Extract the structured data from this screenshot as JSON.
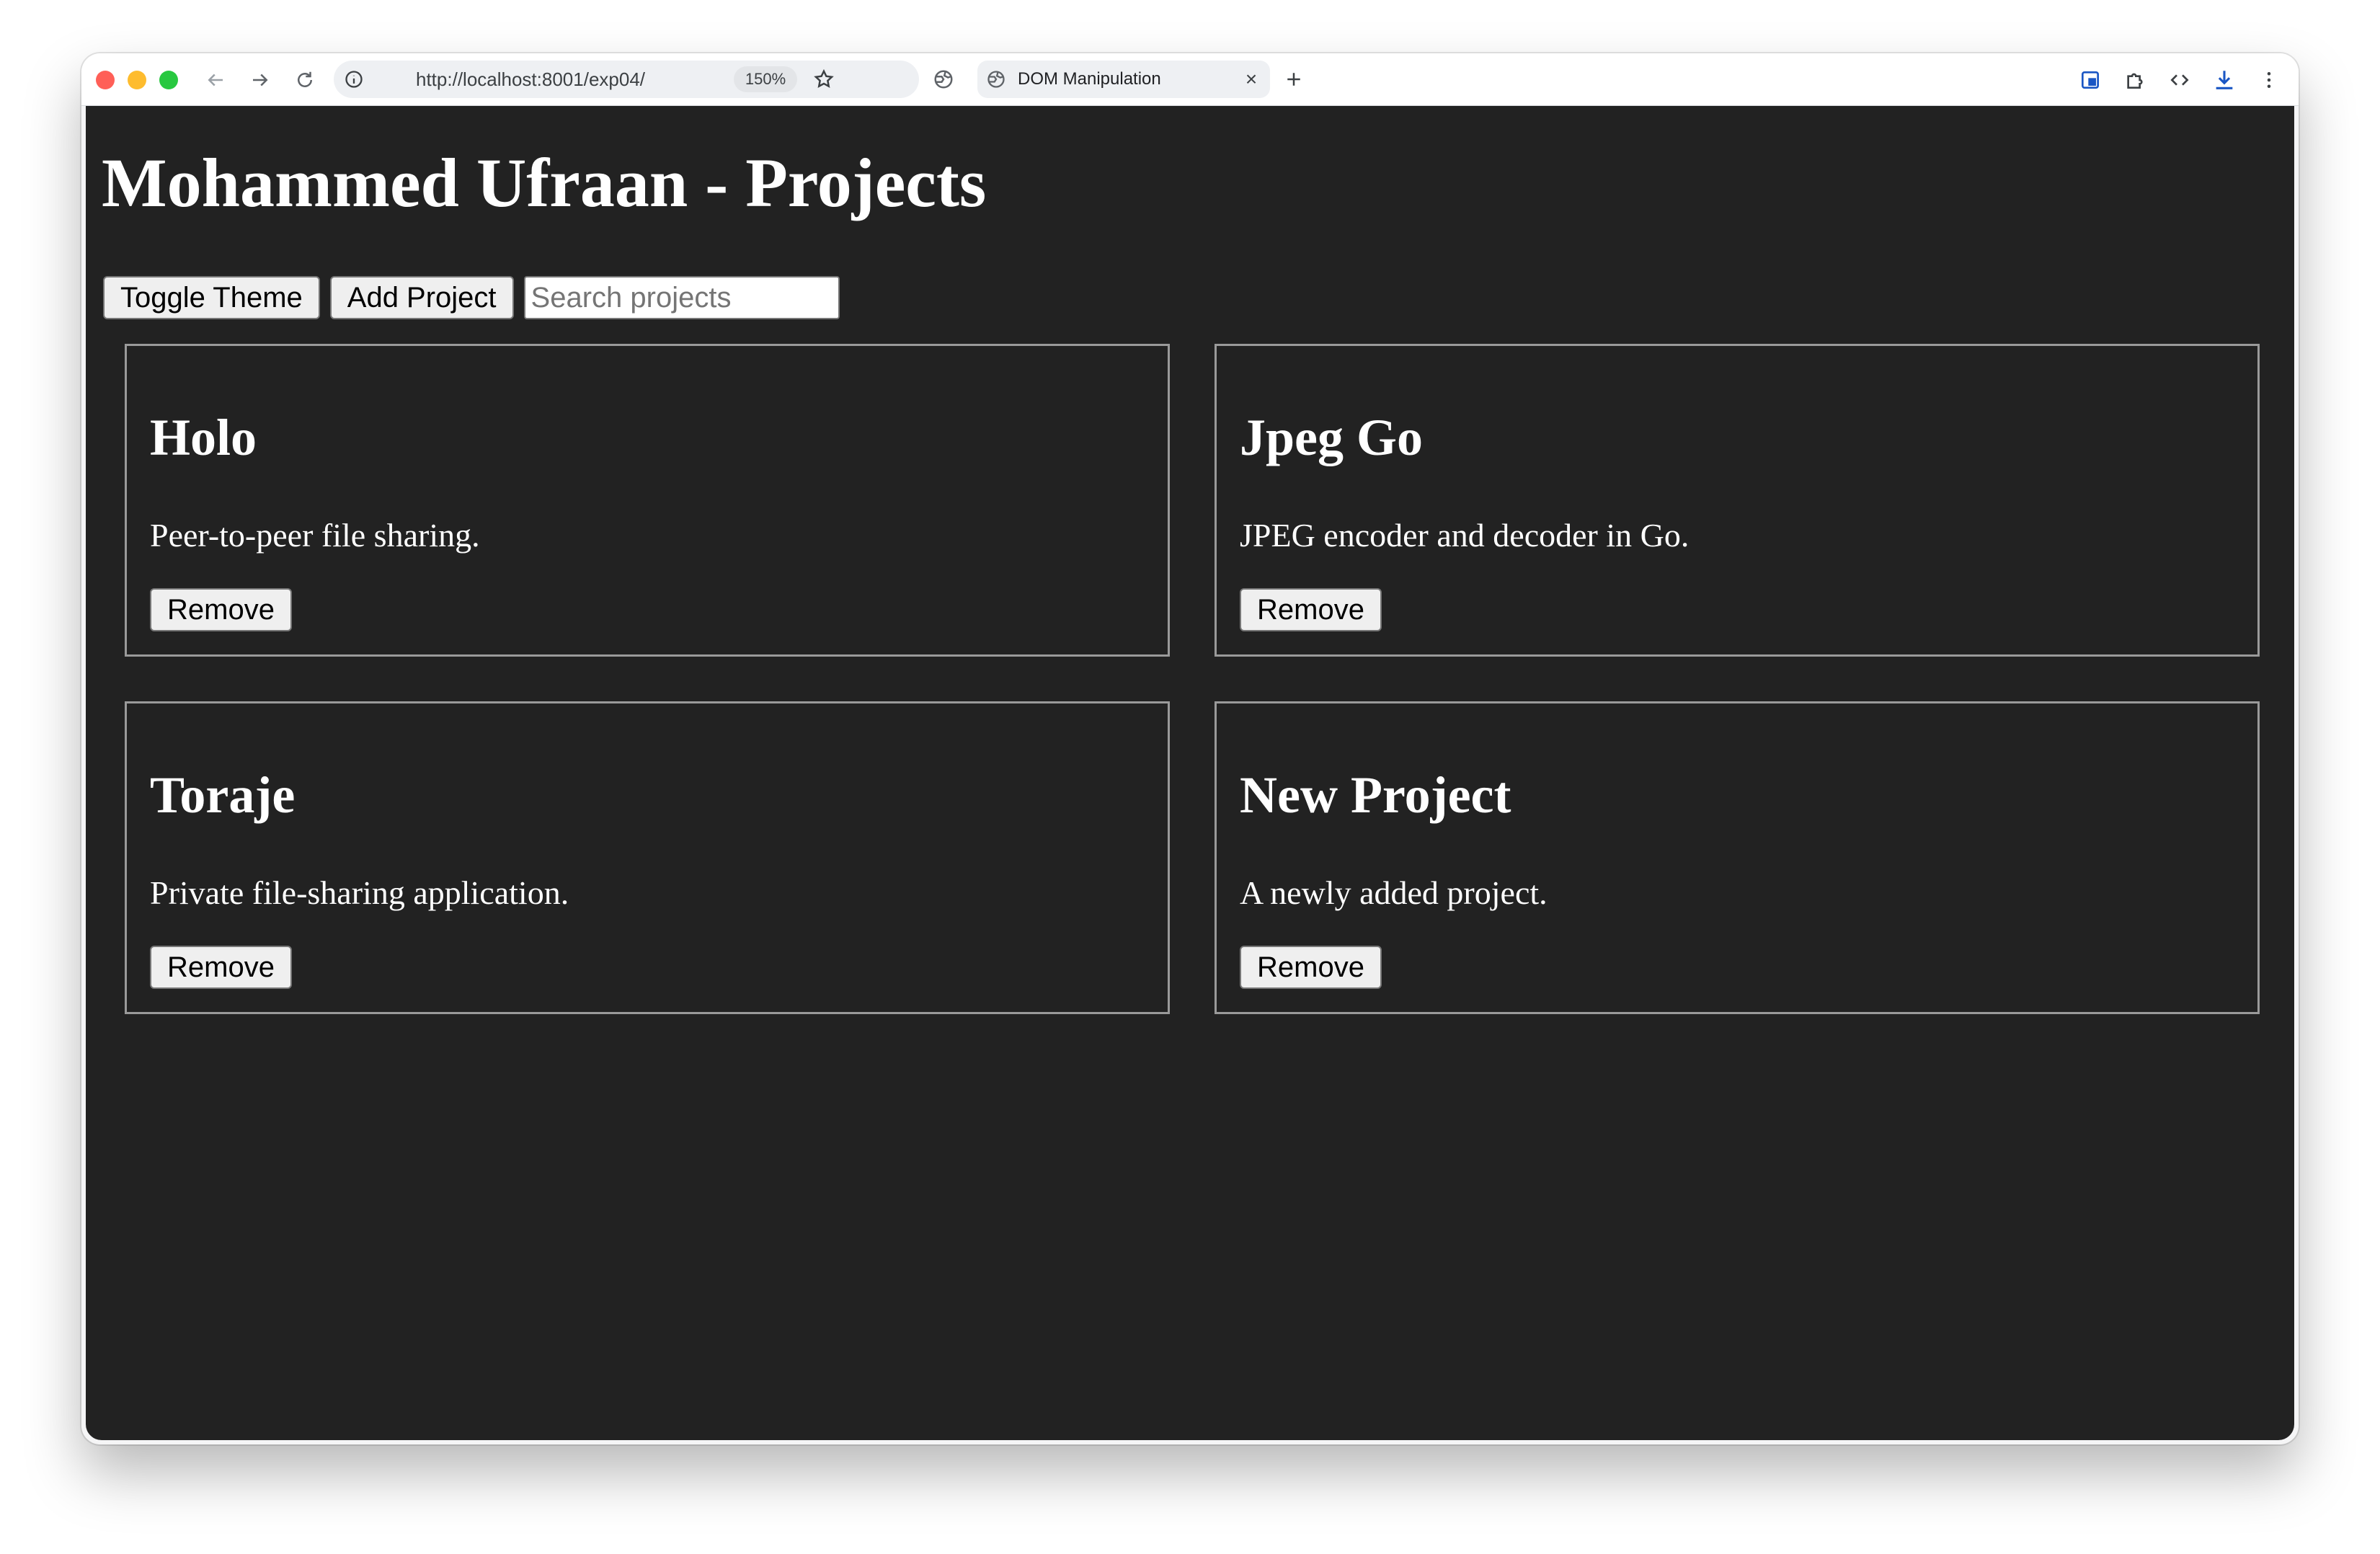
{
  "browser": {
    "url": "http://localhost:8001/exp04/",
    "zoom": "150%",
    "tab_title": "DOM Manipulation",
    "tab_close": "×",
    "new_tab": "+"
  },
  "page": {
    "title": "Mohammed Ufraan - Projects",
    "toggle_theme_label": "Toggle Theme",
    "add_project_label": "Add Project",
    "search_placeholder": "Search projects",
    "remove_label": "Remove",
    "projects": [
      {
        "name": "Holo",
        "description": "Peer-to-peer file sharing."
      },
      {
        "name": "Jpeg Go",
        "description": "JPEG encoder and decoder in Go."
      },
      {
        "name": "Toraje",
        "description": "Private file-sharing application."
      },
      {
        "name": "New Project",
        "description": "A newly added project."
      }
    ]
  },
  "colors": {
    "page_background": "#222222",
    "card_border": "#9a9a9a",
    "text": "#ffffff"
  },
  "icons": [
    "back-icon",
    "forward-icon",
    "reload-icon",
    "site-info-icon",
    "bookmark-star-icon",
    "globe-icon",
    "tab-favicon-icon",
    "extension-icon",
    "puzzle-icon",
    "code-icon",
    "download-icon",
    "menu-icon"
  ]
}
